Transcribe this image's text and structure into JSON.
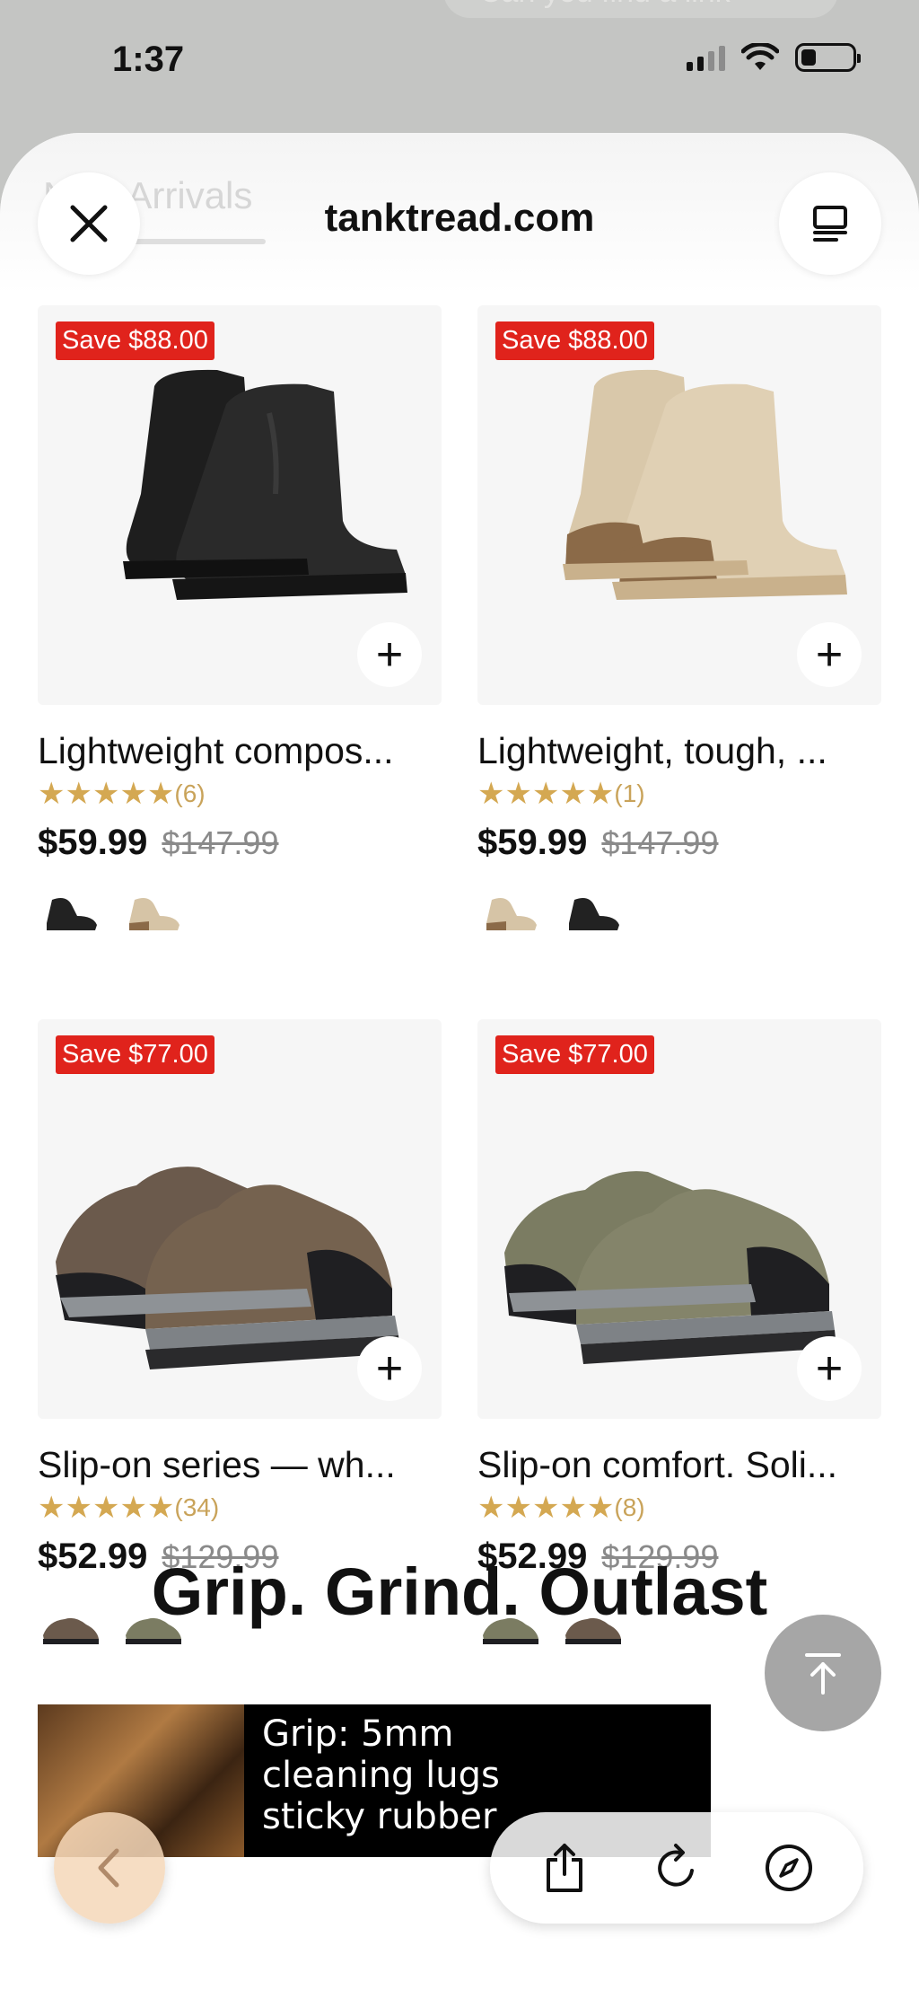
{
  "status_bar": {
    "time": "1:37"
  },
  "background": {
    "bubble_text": "Can you find a link",
    "tab_text": "New Arrivals"
  },
  "header": {
    "domain": "tanktread.com"
  },
  "products": [
    {
      "badge": "Save $88.00",
      "title": "Lightweight compos...",
      "stars": "★★★★★",
      "reviews": "(6)",
      "price": "$59.99",
      "original_price": "$147.99",
      "colors": [
        "black",
        "tan"
      ]
    },
    {
      "badge": "Save $88.00",
      "title": "Lightweight, tough, ...",
      "stars": "★★★★★",
      "reviews": "(1)",
      "price": "$59.99",
      "original_price": "$147.99",
      "colors": [
        "tan",
        "black"
      ]
    },
    {
      "badge": "Save $77.00",
      "title": "Slip-on series — wh...",
      "stars": "★★★★★",
      "reviews": "(34)",
      "price": "$52.99",
      "original_price": "$129.99",
      "colors": [
        "brown",
        "olive"
      ]
    },
    {
      "badge": "Save $77.00",
      "title": "Slip-on comfort. Soli...",
      "stars": "★★★★★",
      "reviews": "(8)",
      "price": "$52.99",
      "original_price": "$129.99",
      "colors": [
        "olive",
        "brown"
      ]
    }
  ],
  "banner": {
    "title": "Grip. Grind. Outlast",
    "promo_text": "Grip: 5mm\ncleaning lugs\nsticky rubber"
  },
  "toolbar": {
    "icons": [
      "share-icon",
      "reload-icon",
      "compass-icon"
    ]
  },
  "colors": {
    "badge": "#e0231c",
    "stars": "#d4a852",
    "black_boot": "#222222",
    "tan_boot": "#d6c4a6",
    "brown_shoe": "#6b5a4c",
    "olive_shoe": "#7b7c62"
  }
}
